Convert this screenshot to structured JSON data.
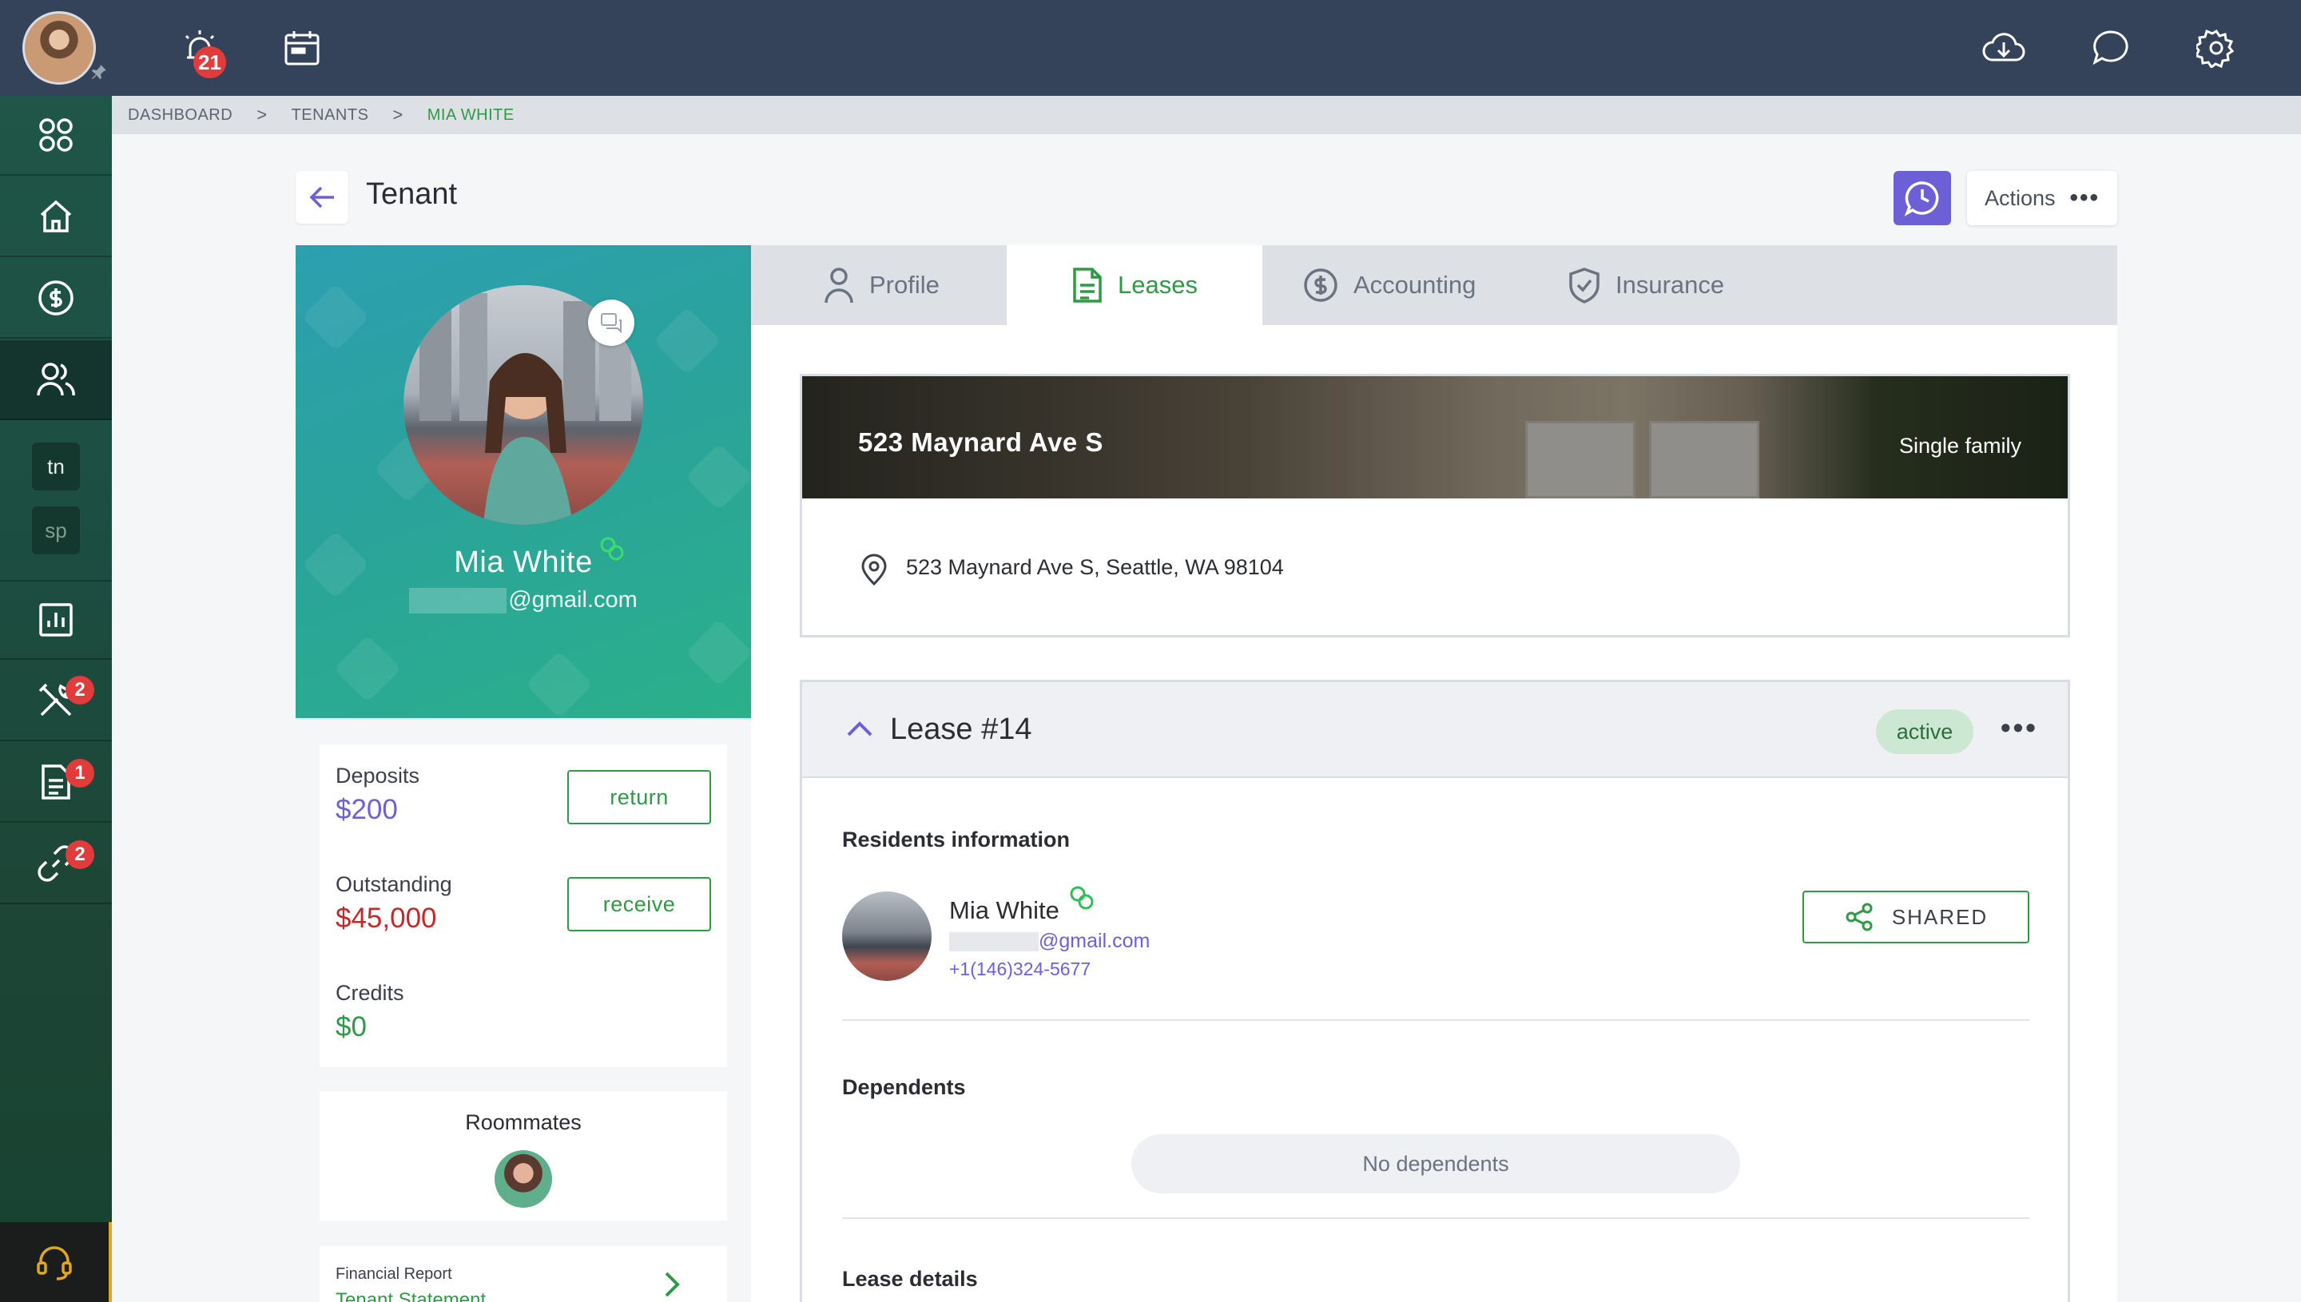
{
  "topbar": {
    "notifications_count": "21",
    "icons": [
      "alarm-icon",
      "calendar-icon",
      "cloud-download-icon",
      "chat-icon",
      "gear-icon"
    ]
  },
  "sidebar": {
    "items": [
      {
        "icon": "apps-grid-icon"
      },
      {
        "icon": "home-icon"
      },
      {
        "icon": "dollar-icon"
      },
      {
        "icon": "users-icon",
        "active": true
      },
      {
        "label": "tn"
      },
      {
        "label": "sp"
      },
      {
        "icon": "chart-icon"
      },
      {
        "icon": "tools-icon",
        "badge": "2"
      },
      {
        "icon": "document-icon",
        "badge": "1"
      },
      {
        "icon": "link-icon",
        "badge": "2"
      },
      {
        "icon": "headset-icon"
      }
    ]
  },
  "breadcrumb": {
    "items": [
      "DASHBOARD",
      "TENANTS",
      "MIA WHITE"
    ],
    "separator": ">"
  },
  "header": {
    "title": "Tenant",
    "actions_label": "Actions",
    "actions_dots": "•••"
  },
  "profile": {
    "name": "Mia White",
    "email_suffix": "@gmail.com"
  },
  "balances": {
    "deposits": {
      "label": "Deposits",
      "value": "$200",
      "button": "return",
      "color": "#6d5fd6"
    },
    "outstanding": {
      "label": "Outstanding",
      "value": "$45,000",
      "button": "receive",
      "color": "#c62828"
    },
    "credits": {
      "label": "Credits",
      "value": "$0",
      "color": "#2f9a45"
    }
  },
  "roommates": {
    "title": "Roommates"
  },
  "report": {
    "title": "Financial Report",
    "subtitle": "Tenant Statement"
  },
  "tabs": [
    {
      "label": "Profile",
      "icon": "person-icon"
    },
    {
      "label": "Leases",
      "icon": "document-icon",
      "active": true
    },
    {
      "label": "Accounting",
      "icon": "dollar-icon"
    },
    {
      "label": "Insurance",
      "icon": "shield-icon"
    }
  ],
  "property": {
    "name": "523 Maynard Ave S",
    "type": "Single family",
    "address": "523 Maynard Ave S, Seattle, WA 98104"
  },
  "lease": {
    "title": "Lease #14",
    "status": "active",
    "dots": "•••",
    "residents_title": "Residents information",
    "resident": {
      "name": "Mia White",
      "email_suffix": "@gmail.com",
      "phone": "+1(146)324-5677"
    },
    "shared_label": "SHARED",
    "dependents_title": "Dependents",
    "no_dependents": "No dependents",
    "lease_details_title": "Lease details"
  },
  "colors": {
    "topbar": "#34425a",
    "accent_green": "#2f9a45",
    "accent_purple": "#6d5fd6",
    "danger": "#c62828"
  }
}
